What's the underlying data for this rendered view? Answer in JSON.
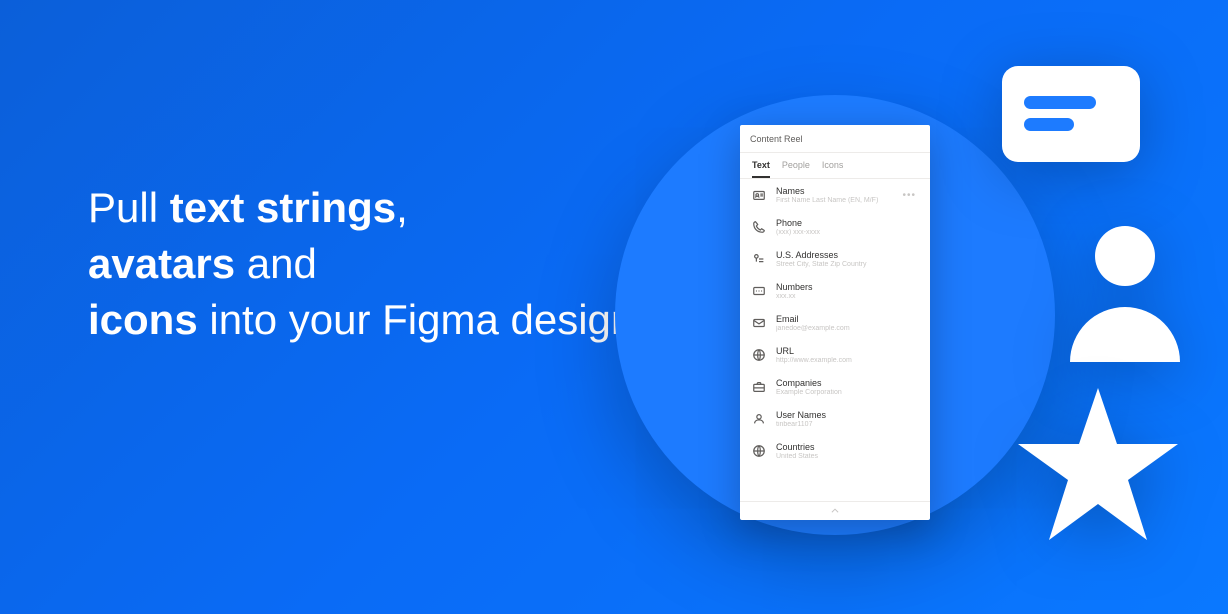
{
  "headline": {
    "part1": "Pull ",
    "bold1": "text strings",
    "part2": ", ",
    "bold2": "avatars",
    "part3": " and ",
    "bold3": "icons",
    "part4": " into your Figma designs"
  },
  "panel": {
    "title": "Content Reel",
    "tabs": [
      {
        "label": "Text",
        "active": true
      },
      {
        "label": "People",
        "active": false
      },
      {
        "label": "Icons",
        "active": false
      }
    ],
    "items": [
      {
        "icon": "name-tag-icon",
        "label": "Names",
        "sub": "First Name Last Name (EN, M/F)",
        "more": true
      },
      {
        "icon": "phone-icon",
        "label": "Phone",
        "sub": "(xxx) xxx-xxxx",
        "more": false
      },
      {
        "icon": "location-icon",
        "label": "U.S. Addresses",
        "sub": "Street City, State Zip Country",
        "more": false
      },
      {
        "icon": "number-icon",
        "label": "Numbers",
        "sub": "xxx.xx",
        "more": false
      },
      {
        "icon": "mail-icon",
        "label": "Email",
        "sub": "janedoe@example.com",
        "more": false
      },
      {
        "icon": "globe-icon",
        "label": "URL",
        "sub": "http://www.example.com",
        "more": false
      },
      {
        "icon": "briefcase-icon",
        "label": "Companies",
        "sub": "Example Corporation",
        "more": false
      },
      {
        "icon": "user-icon",
        "label": "User Names",
        "sub": "tinbear1107",
        "more": false
      },
      {
        "icon": "globe-icon",
        "label": "Countries",
        "sub": "United States",
        "more": false
      }
    ]
  }
}
